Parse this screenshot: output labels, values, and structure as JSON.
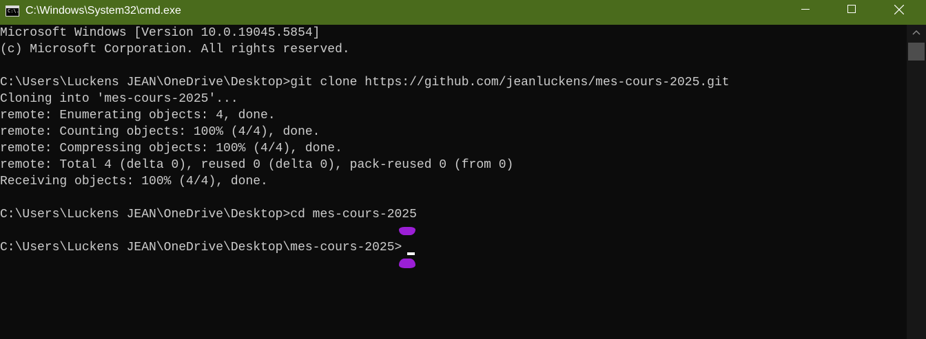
{
  "window": {
    "title": "C:\\Windows\\System32\\cmd.exe",
    "titlebar_color": "#4a6b1c",
    "app_icon": "cmd-icon",
    "app_icon_glyph": "C:\\.",
    "controls": {
      "minimize": "minimize-icon",
      "maximize": "maximize-icon",
      "close": "close-icon"
    }
  },
  "console": {
    "background": "#0c0c0c",
    "foreground": "#cccccc",
    "lines": [
      "Microsoft Windows [Version 10.0.19045.5854]",
      "(c) Microsoft Corporation. All rights reserved.",
      "",
      "C:\\Users\\Luckens JEAN\\OneDrive\\Desktop>git clone https://github.com/jeanluckens/mes-cours-2025.git",
      "Cloning into 'mes-cours-2025'...",
      "remote: Enumerating objects: 4, done.",
      "remote: Counting objects: 100% (4/4), done.",
      "remote: Compressing objects: 100% (4/4), done.",
      "remote: Total 4 (delta 0), reused 0 (delta 0), pack-reused 0 (from 0)",
      "Receiving objects: 100% (4/4), done.",
      "",
      "C:\\Users\\Luckens JEAN\\OneDrive\\Desktop>cd mes-cours-2025",
      "",
      "C:\\Users\\Luckens JEAN\\OneDrive\\Desktop\\mes-cours-2025>"
    ]
  },
  "cursor_marker_color": "#9b1fd6",
  "scrollbar": {
    "up_arrow": "scroll-up-arrow-icon"
  }
}
